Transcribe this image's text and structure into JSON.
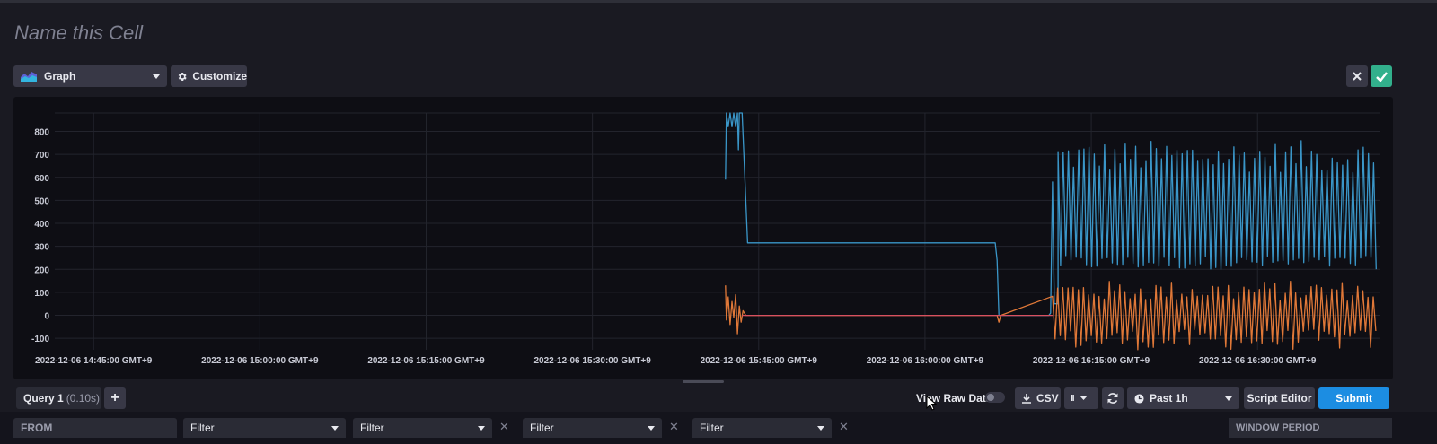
{
  "cell": {
    "name_placeholder": "Name this Cell"
  },
  "toolbar": {
    "visualization": "Graph",
    "customize_label": "Customize"
  },
  "chart_data": {
    "type": "line",
    "title": "",
    "xlabel": "",
    "ylabel": "",
    "x_axis_type": "time",
    "x_ticks": [
      "2022-12-06 14:45:00 GMT+9",
      "2022-12-06 15:00:00 GMT+9",
      "2022-12-06 15:15:00 GMT+9",
      "2022-12-06 15:30:00 GMT+9",
      "2022-12-06 15:45:00 GMT+9",
      "2022-12-06 16:00:00 GMT+9",
      "2022-12-06 16:15:00 GMT+9",
      "2022-12-06 16:30:00 GMT+9"
    ],
    "xlim": [
      "2022-12-06 14:41:30 GMT+9",
      "2022-12-06 16:41:00 GMT+9"
    ],
    "y_ticks": [
      "800",
      "700",
      "600",
      "500",
      "400",
      "300",
      "200",
      "100",
      "0",
      "-100"
    ],
    "ylim": [
      -150,
      880
    ],
    "grid": true,
    "legend": "none",
    "series": [
      {
        "color": "#3a96c8",
        "segments": [
          [
            [
              "2022-12-06 15:42:00",
              590
            ],
            [
              "2022-12-06 15:42:05",
              880
            ],
            [
              "2022-12-06 15:42:15",
              820
            ],
            [
              "2022-12-06 15:42:25",
              880
            ],
            [
              "2022-12-06 15:42:35",
              820
            ],
            [
              "2022-12-06 15:42:45",
              880
            ],
            [
              "2022-12-06 15:42:55",
              820
            ],
            [
              "2022-12-06 15:43:05",
              880
            ],
            [
              "2022-12-06 15:43:10",
              720
            ],
            [
              "2022-12-06 15:43:15",
              880
            ],
            [
              "2022-12-06 15:43:30",
              880
            ],
            [
              "2022-12-06 15:44:00",
              315
            ],
            [
              "2022-12-06 16:06:20",
              315
            ],
            [
              "2022-12-06 16:06:30",
              240
            ],
            [
              "2022-12-06 16:06:40",
              0
            ],
            [
              "2022-12-06 16:11:10",
              0
            ],
            [
              "2022-12-06 16:11:20",
              10
            ],
            [
              "2022-12-06 16:11:30",
              580
            ],
            [
              "2022-12-06 16:11:40",
              50
            ],
            [
              "2022-12-06 16:12:00",
              50
            ]
          ]
        ],
        "oscillation": {
          "start": "2022-12-06 16:12:00",
          "end": "2022-12-06 16:40:50",
          "low_range": [
            200,
            260
          ],
          "high_range": [
            620,
            760
          ]
        }
      },
      {
        "color": "#e07838",
        "segments": [
          [
            [
              "2022-12-06 15:42:00",
              130
            ],
            [
              "2022-12-06 15:42:05",
              -20
            ],
            [
              "2022-12-06 15:42:15",
              80
            ],
            [
              "2022-12-06 15:42:25",
              -40
            ],
            [
              "2022-12-06 15:42:35",
              60
            ],
            [
              "2022-12-06 15:42:45",
              -10
            ],
            [
              "2022-12-06 15:42:55",
              90
            ],
            [
              "2022-12-06 15:43:05",
              -80
            ],
            [
              "2022-12-06 15:43:15",
              40
            ],
            [
              "2022-12-06 15:43:25",
              -30
            ],
            [
              "2022-12-06 15:43:35",
              20
            ],
            [
              "2022-12-06 15:43:50",
              0
            ],
            [
              "2022-12-06 16:06:30",
              0
            ],
            [
              "2022-12-06 16:06:40",
              -30
            ],
            [
              "2022-12-06 16:06:50",
              0
            ]
          ]
        ],
        "oscillation": {
          "start": "2022-12-06 16:11:30",
          "end": "2022-12-06 16:40:50",
          "low_range": [
            -150,
            -60
          ],
          "high_range": [
            60,
            150
          ]
        }
      },
      {
        "color": "#d85060",
        "segments": [
          [
            [
              "2022-12-06 15:43:30",
              0
            ],
            [
              "2022-12-06 16:11:30",
              0
            ]
          ]
        ]
      }
    ]
  },
  "query": {
    "tab_label": "Query 1",
    "tab_time": "(0.10s)",
    "add_label": "+"
  },
  "controls": {
    "view_raw_label": "View Raw Data",
    "csv_label": "CSV",
    "pause_label": "II",
    "time_range": "Past 1h",
    "script_editor_label": "Script Editor",
    "submit_label": "Submit"
  },
  "builder": {
    "from_label": "FROM",
    "filters": [
      "Filter",
      "Filter",
      "Filter",
      "Filter"
    ],
    "window_period_label": "WINDOW PERIOD"
  },
  "icons": {
    "graph": "graph-icon",
    "gear": "gear-icon",
    "close": "close-icon",
    "check": "check-icon",
    "download": "download-icon",
    "pause": "pause-icon",
    "refresh": "refresh-icon",
    "clock": "clock-icon"
  },
  "colors": {
    "submit": "#1c8de2",
    "confirm": "#32b08c",
    "series_blue": "#3a96c8",
    "series_orange": "#e07838",
    "series_red": "#d85060"
  }
}
